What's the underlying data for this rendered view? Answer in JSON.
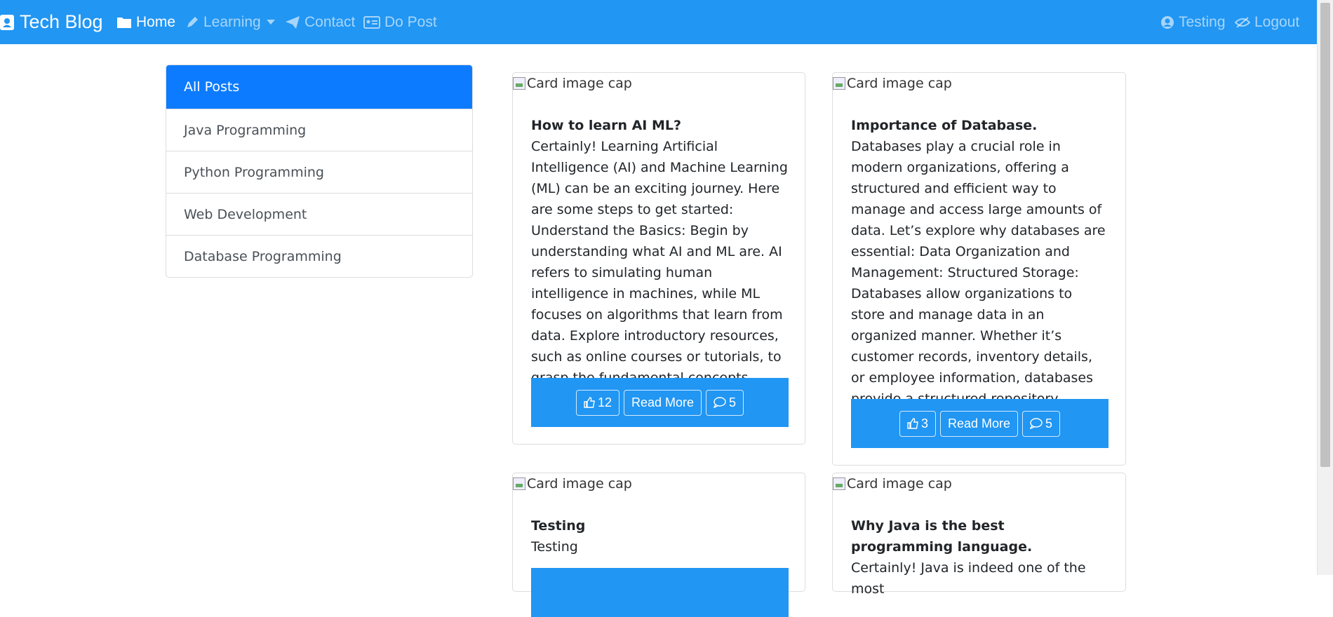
{
  "navbar": {
    "brand": "Tech Blog",
    "home": "Home",
    "learning": "Learning",
    "contact": "Contact",
    "do_post": "Do Post",
    "user": "Testing",
    "logout": "Logout",
    "bg_color": "#2196f3"
  },
  "sidebar": {
    "items": [
      {
        "label": "All Posts"
      },
      {
        "label": "Java Programming"
      },
      {
        "label": "Python Programming"
      },
      {
        "label": "Web Development"
      },
      {
        "label": "Database Programming"
      }
    ],
    "active_color": "#0d7bff"
  },
  "posts": [
    {
      "image_alt": "Card image cap",
      "title": "How to learn AI ML?",
      "text": "Certainly! Learning Artificial Intelligence (AI) and Machine Learning (ML) can be an exciting journey. Here are some steps to get started: Understand the Basics: Begin by understanding what AI and ML are. AI refers to simulating human intelligence in machines, while ML focuses on algorithms that learn from data. Explore introductory resources, such as online courses or tutorials, to grasp the fundamental concepts.",
      "likes": "12",
      "read_more": "Read More",
      "comments": "5"
    },
    {
      "image_alt": "Card image cap",
      "title": "Importance of Database.",
      "text": "Databases play a crucial role in modern organizations, offering a structured and efficient way to manage and access large amounts of data. Let’s explore why databases are essential: Data Organization and Management: Structured Storage: Databases allow organizations to store and manage data in an organized manner. Whether it’s customer records, inventory details, or employee information, databases provide a structured repository.",
      "likes": "3",
      "read_more": "Read More",
      "comments": "5"
    },
    {
      "image_alt": "Card image cap",
      "title": "Testing",
      "text": "Testing"
    },
    {
      "image_alt": "Card image cap",
      "title": "Why Java is the best programming language.",
      "text": "Certainly! Java is indeed one of the most"
    }
  ]
}
